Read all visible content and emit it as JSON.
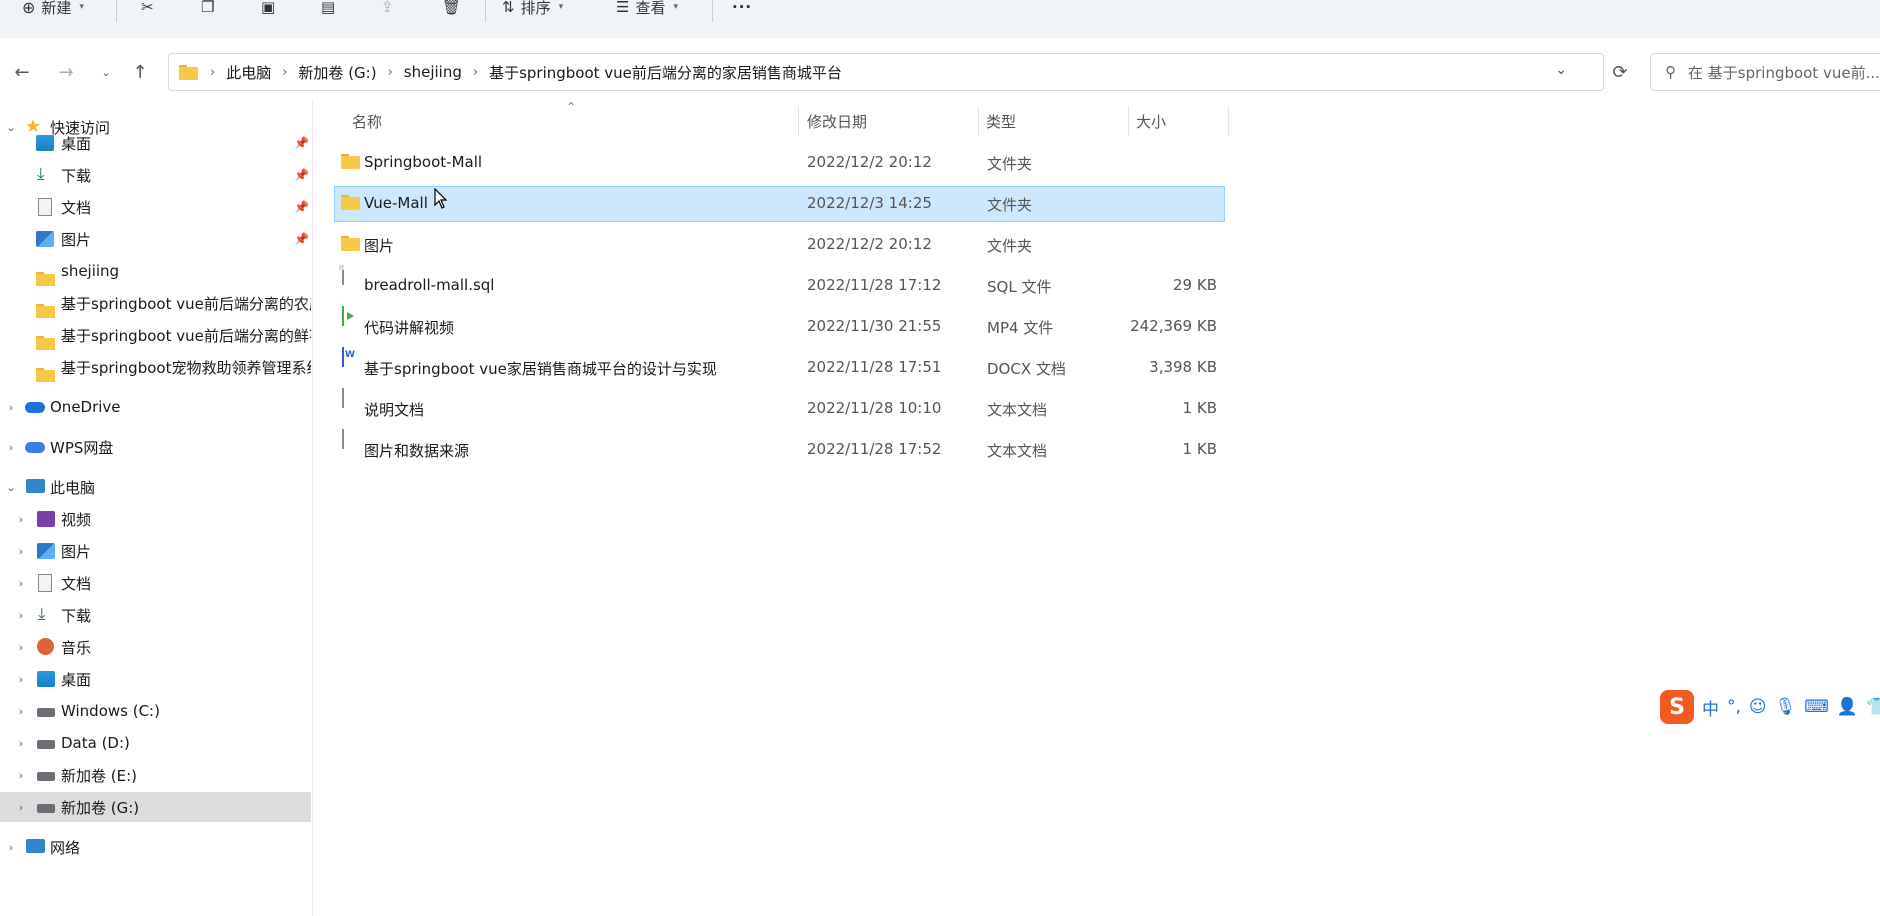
{
  "toolbar": {
    "new_label": "新建",
    "sort_label": "排序",
    "view_label": "查看",
    "more_label": "···"
  },
  "address": {
    "crumbs": [
      "此电脑",
      "新加卷 (G:)",
      "shejiing",
      "基于springboot vue前后端分离的家居销售商城平台"
    ]
  },
  "search": {
    "placeholder": "在 基于springboot vue前..."
  },
  "sidebar": {
    "quick_access": "快速访问",
    "quick_items": [
      {
        "label": "桌面",
        "icon": "desktop-icon",
        "pinned": true
      },
      {
        "label": "下载",
        "icon": "download-icon",
        "pinned": true
      },
      {
        "label": "文档",
        "icon": "document-icon",
        "pinned": true
      },
      {
        "label": "图片",
        "icon": "pictures-icon",
        "pinned": true
      },
      {
        "label": "shejiing",
        "icon": "folder-icon"
      },
      {
        "label": "基于springboot vue前后端分离的农产",
        "icon": "folder-icon"
      },
      {
        "label": "基于springboot vue前后端分离的鲜花",
        "icon": "folder-icon"
      },
      {
        "label": "基于springboot宠物救助领养管理系统",
        "icon": "folder-icon"
      }
    ],
    "onedrive": "OneDrive",
    "wps": "WPS网盘",
    "this_pc": "此电脑",
    "pc_items": [
      {
        "label": "视频",
        "icon": "videos-icon"
      },
      {
        "label": "图片",
        "icon": "pictures-icon"
      },
      {
        "label": "文档",
        "icon": "document-icon"
      },
      {
        "label": "下载",
        "icon": "download-icon"
      },
      {
        "label": "音乐",
        "icon": "music-icon"
      },
      {
        "label": "桌面",
        "icon": "desktop-icon"
      },
      {
        "label": "Windows (C:)",
        "icon": "drive-icon"
      },
      {
        "label": "Data (D:)",
        "icon": "drive-icon"
      },
      {
        "label": "新加卷 (E:)",
        "icon": "drive-icon"
      },
      {
        "label": "新加卷 (G:)",
        "icon": "drive-icon",
        "selected": true
      }
    ],
    "network": "网络"
  },
  "columns": {
    "name": "名称",
    "date": "修改日期",
    "type": "类型",
    "size": "大小"
  },
  "files": [
    {
      "name": "Springboot-Mall",
      "date": "2022/12/2 20:12",
      "type": "文件夹",
      "size": "",
      "icon": "folder-icon"
    },
    {
      "name": "Vue-Mall",
      "date": "2022/12/3 14:25",
      "type": "文件夹",
      "size": "",
      "icon": "folder-icon",
      "selected": true
    },
    {
      "name": "图片",
      "date": "2022/12/2 20:12",
      "type": "文件夹",
      "size": "",
      "icon": "folder-icon"
    },
    {
      "name": "breadroll-mall.sql",
      "date": "2022/11/28 17:12",
      "type": "SQL 文件",
      "size": "29 KB",
      "icon": "file-icon"
    },
    {
      "name": "代码讲解视频",
      "date": "2022/11/30 21:55",
      "type": "MP4 文件",
      "size": "242,369 KB",
      "icon": "video-file-icon"
    },
    {
      "name": "基于springboot vue家居销售商城平台的设计与实现",
      "date": "2022/11/28 17:51",
      "type": "DOCX 文档",
      "size": "3,398 KB",
      "icon": "word-file-icon"
    },
    {
      "name": "说明文档",
      "date": "2022/11/28 10:10",
      "type": "文本文档",
      "size": "1 KB",
      "icon": "text-file-icon"
    },
    {
      "name": "图片和数据来源",
      "date": "2022/11/28 17:52",
      "type": "文本文档",
      "size": "1 KB",
      "icon": "text-file-icon"
    }
  ],
  "ime": {
    "logo": "S",
    "mode": "中"
  }
}
